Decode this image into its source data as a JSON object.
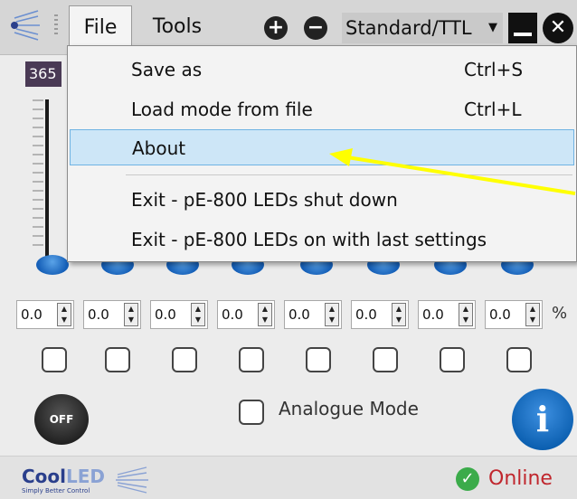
{
  "menubar": {
    "file_label": "File",
    "tools_label": "Tools",
    "mode_select_value": "Standard/TTL"
  },
  "file_menu": {
    "items": [
      {
        "label": "Save as",
        "shortcut": "Ctrl+S"
      },
      {
        "label": "Load mode from file",
        "shortcut": "Ctrl+L"
      },
      {
        "label": "About",
        "shortcut": ""
      },
      {
        "label": "Exit - pE-800 LEDs shut down",
        "shortcut": ""
      },
      {
        "label": "Exit - pE-800 LEDs on with last settings",
        "shortcut": ""
      }
    ],
    "highlighted_item": "About"
  },
  "channels": {
    "wavelength_tag": "365",
    "intensity_values": [
      "0.0",
      "0.0",
      "0.0",
      "0.0",
      "0.0",
      "0.0",
      "0.0",
      "0.0"
    ],
    "unit": "%"
  },
  "controls": {
    "off_label": "OFF",
    "analogue_mode_label": "Analogue Mode",
    "info_label": "i"
  },
  "footer": {
    "brand_cool": "Cool",
    "brand_led": "LED",
    "tagline": "Simply Better Control",
    "status": "Online"
  },
  "annotation": {
    "arrow_color": "#ffff00"
  },
  "colors": {
    "hover_bg": "#cde6f7",
    "accent_blue": "#1660b8",
    "online_green": "#3bab4a",
    "online_text": "#c0262d"
  }
}
